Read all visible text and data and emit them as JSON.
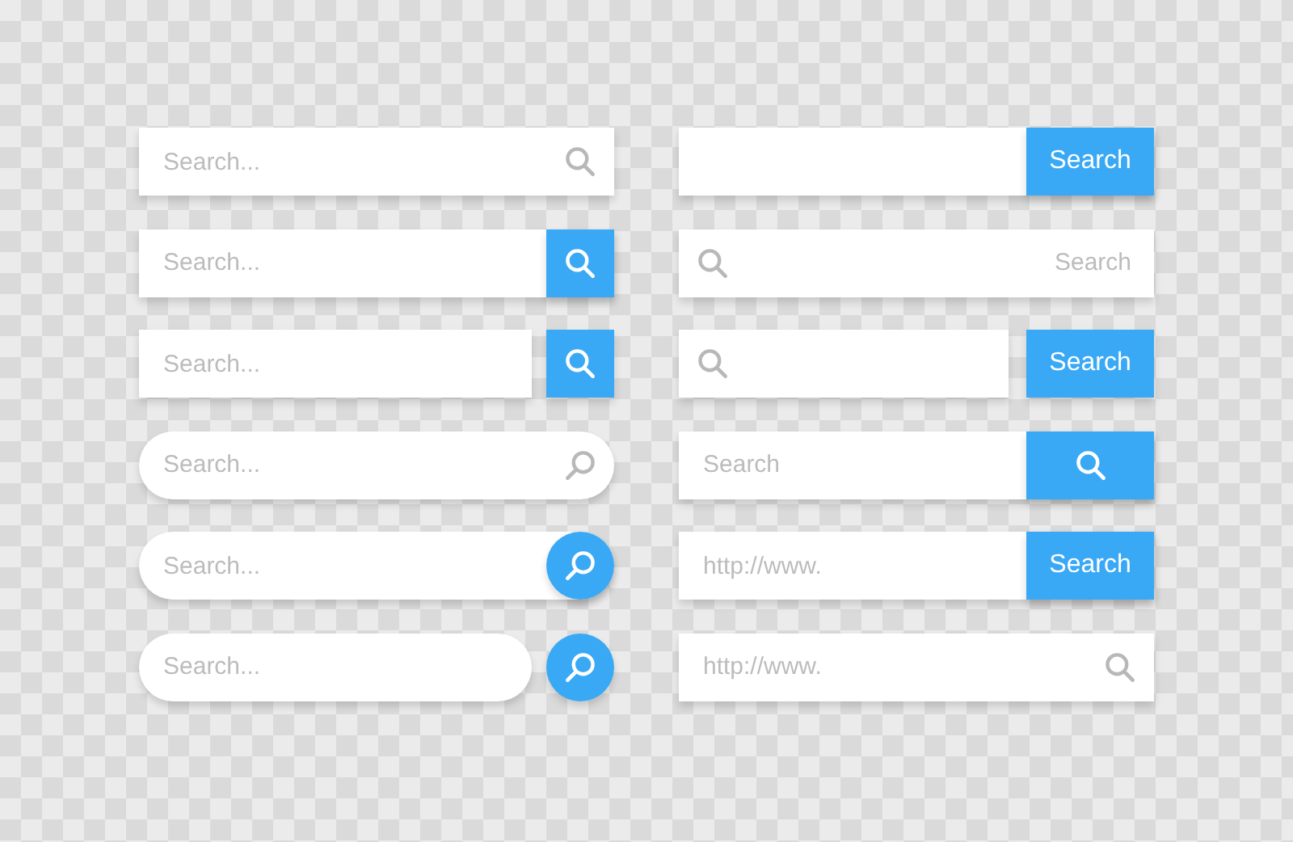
{
  "columns": [
    {
      "bars": [
        {
          "kind": "square",
          "placeholder": "Search...",
          "button": {
            "kind": "inline-icon"
          }
        },
        {
          "kind": "square",
          "placeholder": "Search...",
          "button": {
            "kind": "attached-icon"
          }
        },
        {
          "kind": "square",
          "placeholder": "Search...",
          "button": {
            "kind": "separate-icon"
          }
        },
        {
          "kind": "round",
          "placeholder": "Search...",
          "button": {
            "kind": "inline-icon"
          }
        },
        {
          "kind": "round",
          "placeholder": "Search...",
          "button": {
            "kind": "attached-icon"
          }
        },
        {
          "kind": "round",
          "placeholder": "Search...",
          "button": {
            "kind": "separate-icon"
          }
        }
      ]
    },
    {
      "bars": [
        {
          "kind": "square",
          "button": {
            "kind": "attached-text",
            "label": "Search"
          }
        },
        {
          "kind": "square",
          "leading_icon": true,
          "placeholder": "Search",
          "placeholder_right": true
        },
        {
          "kind": "square",
          "leading_icon": true,
          "button": {
            "kind": "separate-text",
            "label": "Search"
          }
        },
        {
          "kind": "square",
          "placeholder": "Search",
          "button": {
            "kind": "attached-icon",
            "wide": true
          }
        },
        {
          "kind": "square",
          "placeholder": "http://www.",
          "button": {
            "kind": "attached-text",
            "label": "Search"
          }
        },
        {
          "kind": "square",
          "placeholder": "http://www.",
          "button": {
            "kind": "inline-icon"
          }
        }
      ]
    }
  ]
}
